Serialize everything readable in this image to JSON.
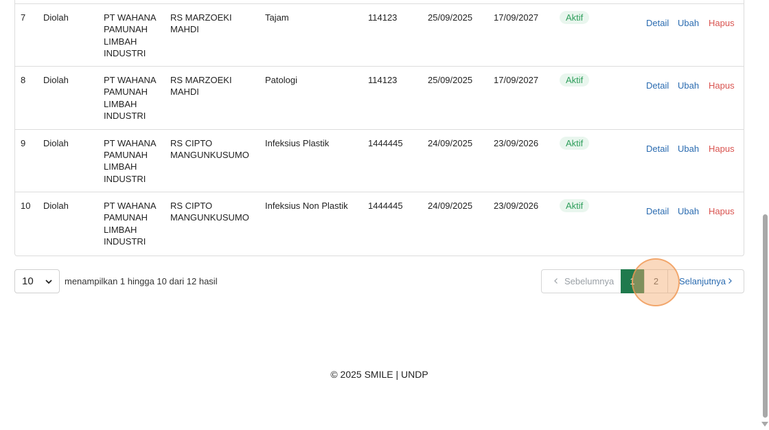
{
  "table": {
    "rows": [
      {
        "no": "7",
        "status": "Diolah",
        "company": "PT WAHANA PAMUNAH LIMBAH INDUSTRI",
        "hospital": "RS MARZOEKI MAHDI",
        "waste_type": "Tajam",
        "code": "114123",
        "start_date": "25/09/2025",
        "end_date": "17/09/2027",
        "badge": "Aktif"
      },
      {
        "no": "8",
        "status": "Diolah",
        "company": "PT WAHANA PAMUNAH LIMBAH INDUSTRI",
        "hospital": "RS MARZOEKI MAHDI",
        "waste_type": "Patologi",
        "code": "114123",
        "start_date": "25/09/2025",
        "end_date": "17/09/2027",
        "badge": "Aktif"
      },
      {
        "no": "9",
        "status": "Diolah",
        "company": "PT WAHANA PAMUNAH LIMBAH INDUSTRI",
        "hospital": "RS CIPTO MANGUNKUSUMO",
        "waste_type": "Infeksius Plastik",
        "code": "1444445",
        "start_date": "24/09/2025",
        "end_date": "23/09/2026",
        "badge": "Aktif"
      },
      {
        "no": "10",
        "status": "Diolah",
        "company": "PT WAHANA PAMUNAH LIMBAH INDUSTRI",
        "hospital": "RS CIPTO MANGUNKUSUMO",
        "waste_type": "Infeksius Non Plastik",
        "code": "1444445",
        "start_date": "24/09/2025",
        "end_date": "23/09/2026",
        "badge": "Aktif"
      }
    ],
    "actions": {
      "detail": "Detail",
      "edit": "Ubah",
      "delete": "Hapus"
    }
  },
  "pagination": {
    "per_page": "10",
    "showing_text": "menampilkan 1 hingga 10 dari 12 hasil",
    "prev_label": "Sebelumnya",
    "next_label": "Selanjutnya",
    "pages": [
      "1",
      "2"
    ],
    "current_page": "1"
  },
  "footer": {
    "text": "© 2025 SMILE | UNDP"
  },
  "colors": {
    "primary": "#1f7a4d",
    "link": "#2a6bb0",
    "danger": "#d9534f",
    "badge_text": "#2e9e5b",
    "badge_bg": "#e9f6ee"
  }
}
